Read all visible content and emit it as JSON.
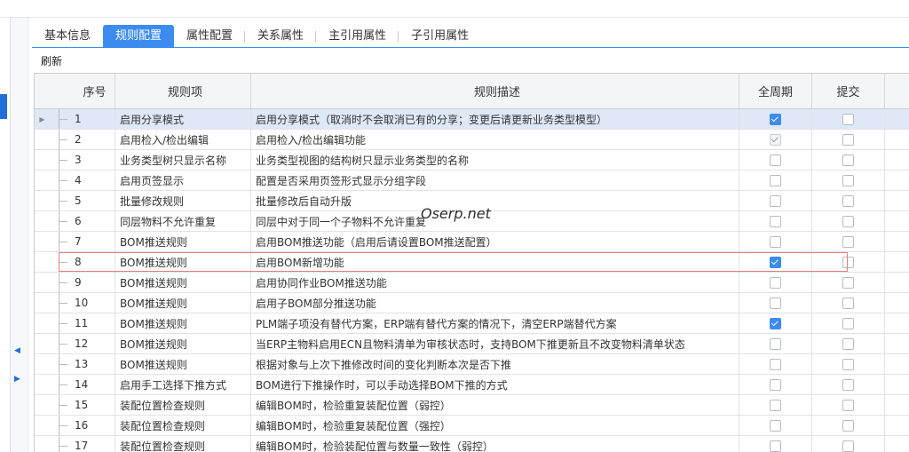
{
  "tabs": [
    {
      "label": "基本信息",
      "active": false
    },
    {
      "label": "规则配置",
      "active": true
    },
    {
      "label": "属性配置",
      "active": false
    },
    {
      "label": "关系属性",
      "active": false
    },
    {
      "label": "主引用属性",
      "active": false
    },
    {
      "label": "子引用属性",
      "active": false
    }
  ],
  "toolbar": {
    "refresh_label": "刷新"
  },
  "columns": {
    "seq": "序号",
    "rule": "规则项",
    "desc": "规则描述",
    "full": "全周期",
    "submit": "提交"
  },
  "rows": [
    {
      "seq": "1",
      "rule": "启用分享模式",
      "desc": "启用分享模式（取消时不会取消已有的分享；变更后请更新业务类型模型）",
      "full": "checked",
      "submit": "unchecked"
    },
    {
      "seq": "2",
      "rule": "启用检入/检出编辑",
      "desc": "启用检入/检出编辑功能",
      "full": "checked-disabled",
      "submit": "unchecked"
    },
    {
      "seq": "3",
      "rule": "业务类型树只显示名称",
      "desc": "业务类型视图的结构树只显示业务类型的名称",
      "full": "unchecked",
      "submit": "unchecked"
    },
    {
      "seq": "4",
      "rule": "启用页签显示",
      "desc": "配置是否采用页签形式显示分组字段",
      "full": "unchecked",
      "submit": "unchecked"
    },
    {
      "seq": "5",
      "rule": "批量修改规则",
      "desc": "批量修改后自动升版",
      "full": "unchecked",
      "submit": "unchecked"
    },
    {
      "seq": "6",
      "rule": "同层物料不允许重复",
      "desc": "同层中对于同一个子物料不允许重复",
      "full": "unchecked",
      "submit": "unchecked"
    },
    {
      "seq": "7",
      "rule": "BOM推送规则",
      "desc": "启用BOM推送功能（启用后请设置BOM推送配置）",
      "full": "unchecked",
      "submit": "unchecked"
    },
    {
      "seq": "8",
      "rule": "BOM推送规则",
      "desc": "启用BOM新增功能",
      "full": "checked",
      "submit": "unchecked"
    },
    {
      "seq": "9",
      "rule": "BOM推送规则",
      "desc": "启用协同作业BOM推送功能",
      "full": "unchecked",
      "submit": "unchecked"
    },
    {
      "seq": "10",
      "rule": "BOM推送规则",
      "desc": "启用子BOM部分推送功能",
      "full": "unchecked",
      "submit": "unchecked"
    },
    {
      "seq": "11",
      "rule": "BOM推送规则",
      "desc": "PLM端子项没有替代方案，ERP端有替代方案的情况下，清空ERP端替代方案",
      "full": "checked",
      "submit": "unchecked"
    },
    {
      "seq": "12",
      "rule": "BOM推送规则",
      "desc": "当ERP主物料启用ECN且物料清单为审核状态时，支持BOM下推更新且不改变物料清单状态",
      "full": "unchecked",
      "submit": "unchecked"
    },
    {
      "seq": "13",
      "rule": "BOM推送规则",
      "desc": "根据对象与上次下推修改时间的变化判断本次是否下推",
      "full": "unchecked",
      "submit": "unchecked"
    },
    {
      "seq": "14",
      "rule": "启用手工选择下推方式",
      "desc": "BOM进行下推操作时，可以手动选择BOM下推的方式",
      "full": "unchecked",
      "submit": "unchecked"
    },
    {
      "seq": "15",
      "rule": "装配位置检查规则",
      "desc": "编辑BOM时，检验重复装配位置（弱控）",
      "full": "unchecked",
      "submit": "unchecked"
    },
    {
      "seq": "16",
      "rule": "装配位置检查规则",
      "desc": "编辑BOM时，检验重复装配位置（强控）",
      "full": "unchecked",
      "submit": "unchecked"
    },
    {
      "seq": "17",
      "rule": "装配位置检查规则",
      "desc": "编辑BOM时，检验装配位置与数量一致性（弱控）",
      "full": "unchecked",
      "submit": "unchecked"
    }
  ],
  "watermark": "Oserp.net",
  "colors": {
    "accent": "#3c8cf0",
    "highlight_border": "#e77d7d",
    "selected_row": "#dfe8f7"
  }
}
